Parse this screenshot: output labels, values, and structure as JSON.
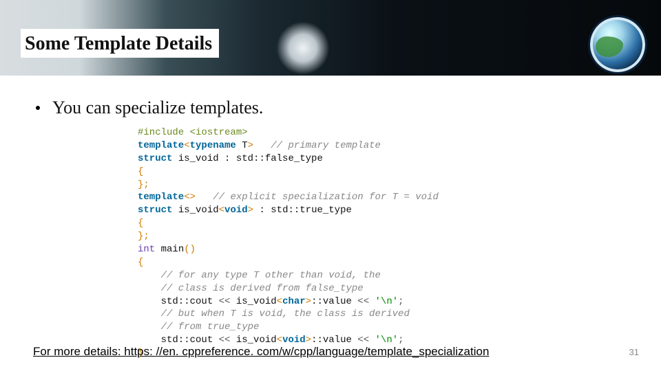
{
  "header": {
    "title": "Some Template Details"
  },
  "bullet": {
    "text": "You can specialize templates."
  },
  "code": {
    "l01a": "#include <iostream>",
    "l02a": "template",
    "l02b": "<",
    "l02c": "typename",
    "l02d": " T",
    "l02e": ">",
    "l02f": "   // primary template",
    "l03a": "struct",
    "l03b": " is_void : std::false_type",
    "l04a": "{",
    "l05a": "};",
    "l06a": "template",
    "l06b": "<>",
    "l06c": "   // explicit specialization for T = void",
    "l07a": "struct",
    "l07b": " is_void",
    "l07c": "<",
    "l07d": "void",
    "l07e": ">",
    "l07f": " : std::true_type",
    "l08a": "{",
    "l09a": "};",
    "l10a": "int",
    "l10b": " main",
    "l10c": "()",
    "l11a": "{",
    "l12a": "    // for any type T other than void, the",
    "l13a": "    // class is derived from false_type",
    "l14a": "    std::cout ",
    "l14b": "<<",
    "l14c": " is_void",
    "l14d": "<",
    "l14e": "char",
    "l14f": ">",
    "l14g": "::value ",
    "l14h": "<<",
    "l14i": " '\\n'",
    "l14j": ";",
    "l15a": "    // but when T is void, the class is derived",
    "l16a": "    // from true_type",
    "l17a": "    std::cout ",
    "l17b": "<<",
    "l17c": " is_void",
    "l17d": "<",
    "l17e": "void",
    "l17f": ">",
    "l17g": "::value ",
    "l17h": "<<",
    "l17i": " '\\n'",
    "l17j": ";",
    "l18a": "}"
  },
  "footer": {
    "link_text": "For more details: https: //en. cppreference. com/w/cpp/language/template_specialization",
    "page": "31"
  }
}
